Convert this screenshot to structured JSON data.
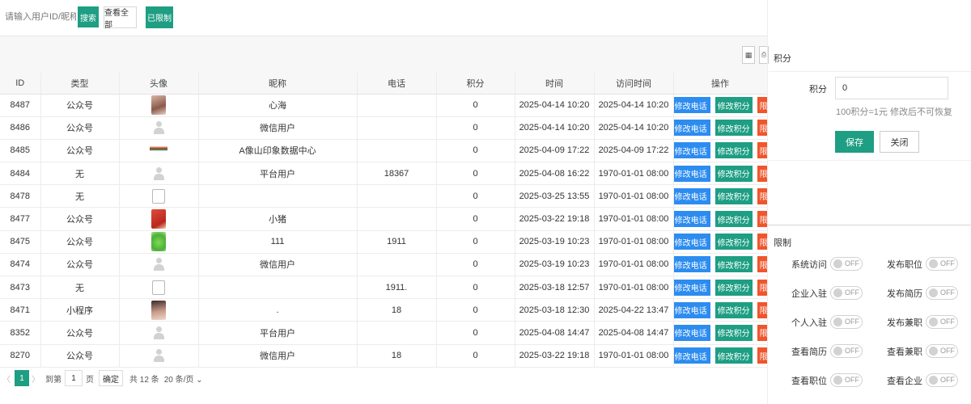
{
  "toolbar": {
    "search_placeholder": "请输入用户ID/昵称/电话",
    "search_label": "搜索",
    "view_all_label": "查看全部",
    "restricted_label": "已限制"
  },
  "table": {
    "columns": [
      "ID",
      "类型",
      "头像",
      "昵称",
      "电话",
      "积分",
      "时间",
      "访问时间",
      "操作"
    ],
    "rows": [
      {
        "id": "8487",
        "type": "公众号",
        "avatar": "photo",
        "nickname": "心海",
        "phone": "",
        "points": "0",
        "time": "2025-04-14 10:20",
        "visit": "2025-04-14 10:20"
      },
      {
        "id": "8486",
        "type": "公众号",
        "avatar": "default",
        "nickname": "微信用户",
        "phone": "",
        "points": "0",
        "time": "2025-04-14 10:20",
        "visit": "2025-04-14 10:20"
      },
      {
        "id": "8485",
        "type": "公众号",
        "avatar": "logo",
        "nickname": "A像山印象数据中心",
        "phone": "",
        "points": "0",
        "time": "2025-04-09 17:22",
        "visit": "2025-04-09 17:22"
      },
      {
        "id": "8484",
        "type": "无",
        "avatar": "default",
        "nickname": "平台用户",
        "phone": "18367",
        "points": "0",
        "time": "2025-04-08 16:22",
        "visit": "1970-01-01 08:00"
      },
      {
        "id": "8478",
        "type": "无",
        "avatar": "broken",
        "nickname": "",
        "phone": "",
        "points": "0",
        "time": "2025-03-25 13:55",
        "visit": "1970-01-01 08:00"
      },
      {
        "id": "8477",
        "type": "公众号",
        "avatar": "red",
        "nickname": "小猪",
        "phone": "",
        "points": "0",
        "time": "2025-03-22 19:18",
        "visit": "1970-01-01 08:00"
      },
      {
        "id": "8475",
        "type": "公众号",
        "avatar": "frog",
        "nickname": "111",
        "phone": "1911",
        "points": "0",
        "time": "2025-03-19 10:23",
        "visit": "1970-01-01 08:00"
      },
      {
        "id": "8474",
        "type": "公众号",
        "avatar": "default",
        "nickname": "微信用户",
        "phone": "",
        "points": "0",
        "time": "2025-03-19 10:23",
        "visit": "1970-01-01 08:00"
      },
      {
        "id": "8473",
        "type": "无",
        "avatar": "broken",
        "nickname": "",
        "phone": "1911.",
        "points": "0",
        "time": "2025-03-18 12:57",
        "visit": "1970-01-01 08:00"
      },
      {
        "id": "8471",
        "type": "小程序",
        "avatar": "girl",
        "nickname": ".",
        "phone": "18",
        "points": "0",
        "time": "2025-03-18 12:30",
        "visit": "2025-04-22 13:47"
      },
      {
        "id": "8352",
        "type": "公众号",
        "avatar": "default",
        "nickname": "平台用户",
        "phone": "",
        "points": "0",
        "time": "2025-04-08 14:47",
        "visit": "2025-04-08 14:47"
      },
      {
        "id": "8270",
        "type": "公众号",
        "avatar": "default",
        "nickname": "微信用户",
        "phone": "18",
        "points": "0",
        "time": "2025-03-22 19:18",
        "visit": "1970-01-01 08:00"
      }
    ],
    "op_labels": {
      "edit_phone": "✓ 修改电话",
      "edit_points": "修改积分",
      "limit": "限制"
    }
  },
  "pager": {
    "prev": "〈",
    "current_page": "1",
    "next": "〉",
    "goto_prefix": "到第",
    "goto_value": "1",
    "goto_suffix": "页",
    "confirm": "确定",
    "total": "共 12 条",
    "per_page": "20 条/页 ⌄"
  },
  "points_panel": {
    "title": "积分",
    "field_label": "积分",
    "field_value": "0",
    "hint": "100积分=1元 修改后不可恢复",
    "save_label": "保存",
    "close_label": "关闭"
  },
  "limit_panel": {
    "title": "限制",
    "off_text": "OFF",
    "toggles": [
      {
        "label": "系统访问",
        "state": "OFF"
      },
      {
        "label": "发布职位",
        "state": "OFF"
      },
      {
        "label": "企业入驻",
        "state": "OFF"
      },
      {
        "label": "发布简历",
        "state": "OFF"
      },
      {
        "label": "个人入驻",
        "state": "OFF"
      },
      {
        "label": "发布兼职",
        "state": "OFF"
      },
      {
        "label": "查看简历",
        "state": "OFF"
      },
      {
        "label": "查看兼职",
        "state": "OFF"
      },
      {
        "label": "查看职位",
        "state": "OFF"
      },
      {
        "label": "查看企业",
        "state": "OFF"
      }
    ]
  },
  "colors": {
    "primary": "#1e9e83",
    "blue": "#2d8cf0",
    "orange_red": "#f0552c"
  }
}
